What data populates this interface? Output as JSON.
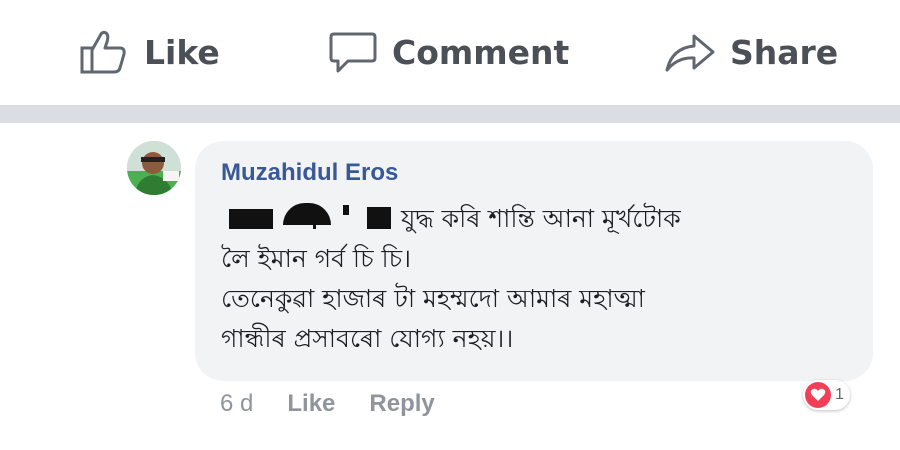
{
  "actions": {
    "like_label": "Like",
    "comment_label": "Comment",
    "share_label": "Share"
  },
  "comment": {
    "author": "Muzahidul Eros",
    "lines": [
      "যুদ্ধ কৰি শান্তি আনা মূৰ্খটোক",
      "লৈ ইমান গৰ্ব চি চি।",
      "তেনেকুৱা হাজাৰ টা মহম্মদো আমাৰ মহাত্মা",
      "গান্ধীৰ প্ৰসাবৰো যোগ্য নহয়।।"
    ],
    "time": "6 d",
    "like_label": "Like",
    "reply_label": "Reply",
    "reaction": {
      "icon": "heart-icon",
      "count": "1"
    }
  },
  "colors": {
    "author": "#385898",
    "action_text": "#4b4f56",
    "meta_text": "#90949c",
    "bubble": "#f2f3f5",
    "divider": "#dadde1",
    "heart": "#f33e58"
  }
}
